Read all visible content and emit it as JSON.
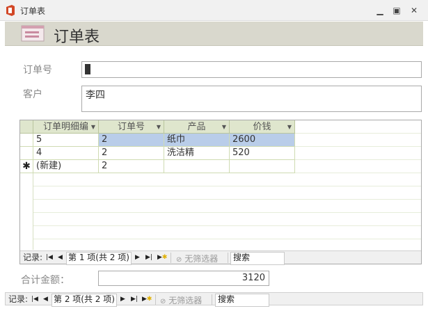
{
  "window": {
    "title": "订单表"
  },
  "header": {
    "title": "订单表"
  },
  "form": {
    "order_no_label": "订单号",
    "order_no_value": "",
    "customer_label": "客户",
    "customer_value": "李四",
    "total_label": "合计金额：",
    "total_value": "3120"
  },
  "subform": {
    "columns": [
      "订单明细编",
      "订单号",
      "产品",
      "价钱"
    ],
    "rows": [
      [
        "5",
        "2",
        "纸巾",
        "2600"
      ],
      [
        "4",
        "2",
        "洗洁精",
        "520"
      ]
    ],
    "new_row": {
      "selector": "✱",
      "id": "(新建)",
      "order_no": "2"
    },
    "nav": {
      "record_label": "记录:",
      "record_status": "第 1 项(共 2 项)",
      "filter_label": "无筛选器",
      "search_label": "搜索"
    }
  },
  "main_nav": {
    "record_label": "记录:",
    "record_status": "第 2 项(共 2 项)",
    "filter_label": "无筛选器",
    "search_label": "搜索"
  },
  "colors": {
    "header_band": "#d9d8cd",
    "grid_header": "#dfe6cd",
    "selected_row": "#b9cde9",
    "office_icon": "#d24726"
  }
}
